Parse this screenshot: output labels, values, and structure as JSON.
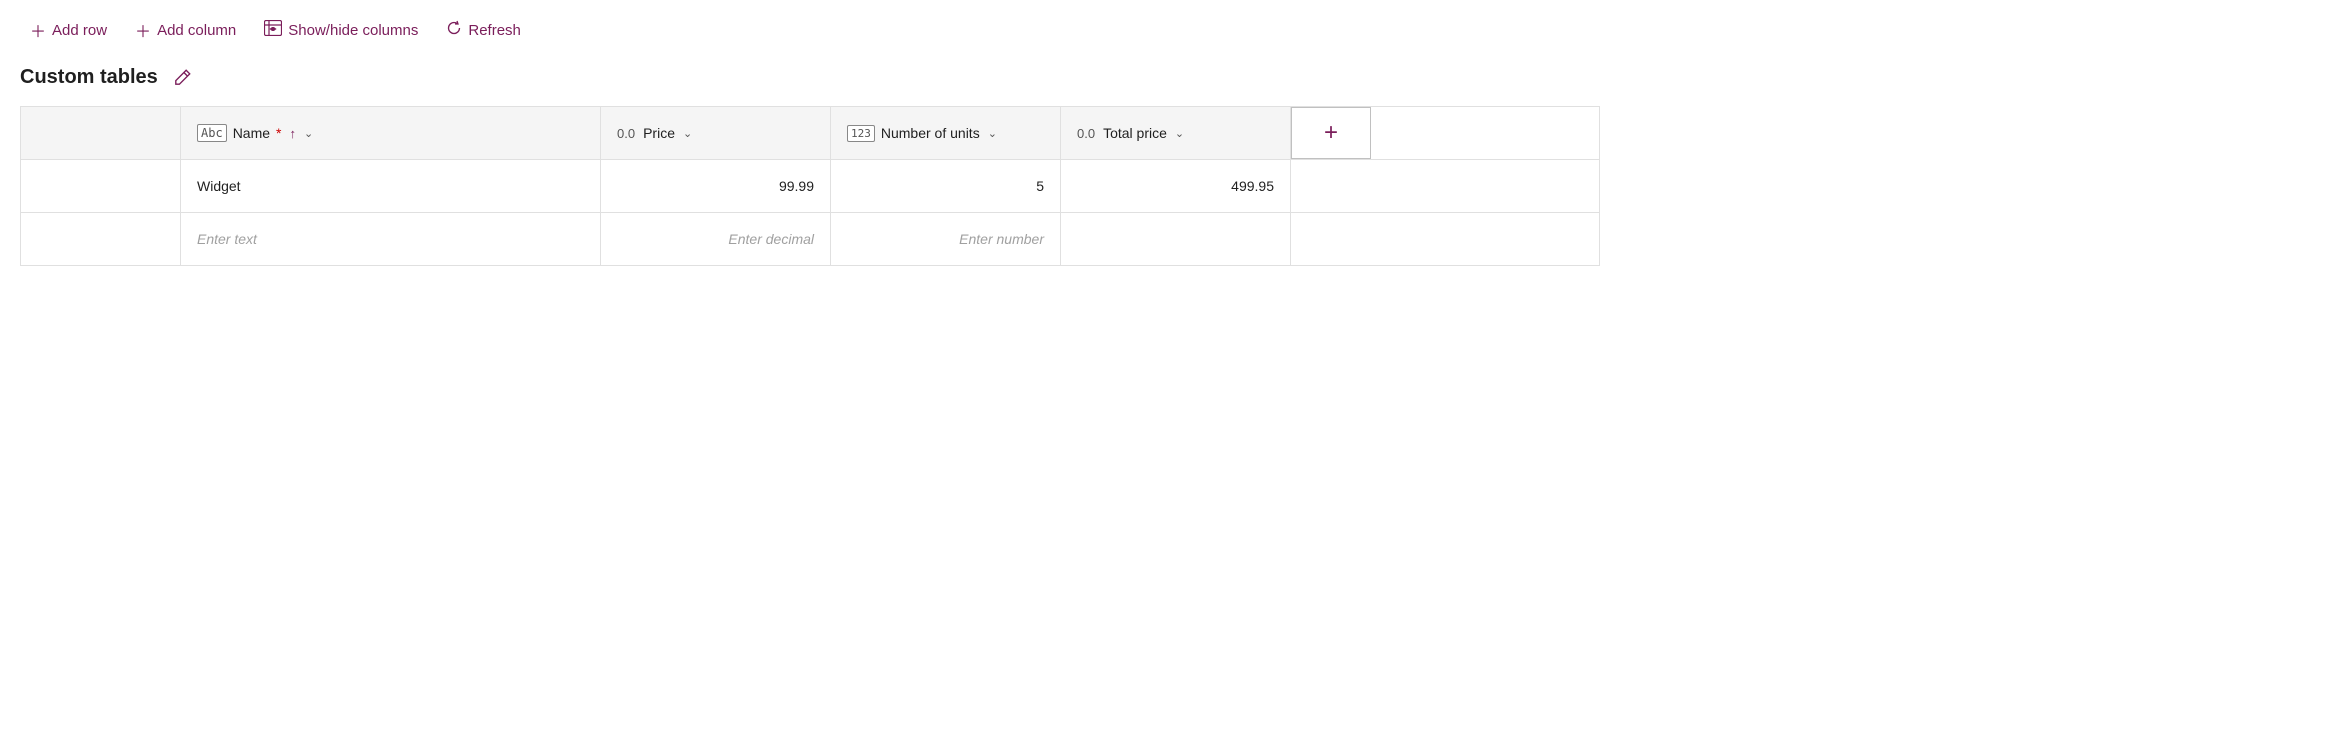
{
  "toolbar": {
    "add_row_label": "Add row",
    "add_column_label": "Add column",
    "show_hide_label": "Show/hide columns",
    "refresh_label": "Refresh"
  },
  "page_title": "Custom tables",
  "columns": [
    {
      "id": "name",
      "type_icon": "Abc",
      "type_icon_style": "text",
      "label": "Name",
      "required": true,
      "sort": "asc",
      "has_chevron": true,
      "align": "left"
    },
    {
      "id": "price",
      "type_icon": "0.0",
      "type_icon_style": "plain",
      "label": "Price",
      "required": false,
      "sort": null,
      "has_chevron": true,
      "align": "right"
    },
    {
      "id": "units",
      "type_icon": "123",
      "type_icon_style": "box",
      "label": "Number of units",
      "required": false,
      "sort": null,
      "has_chevron": true,
      "align": "right"
    },
    {
      "id": "total",
      "type_icon": "0.0",
      "type_icon_style": "plain",
      "label": "Total price",
      "required": false,
      "sort": null,
      "has_chevron": true,
      "align": "right"
    }
  ],
  "rows": [
    {
      "name": "Widget",
      "price": "99.99",
      "units": "5",
      "total": "499.95"
    }
  ],
  "empty_row": {
    "name_placeholder": "Enter text",
    "price_placeholder": "Enter decimal",
    "units_placeholder": "Enter number",
    "total_placeholder": ""
  }
}
